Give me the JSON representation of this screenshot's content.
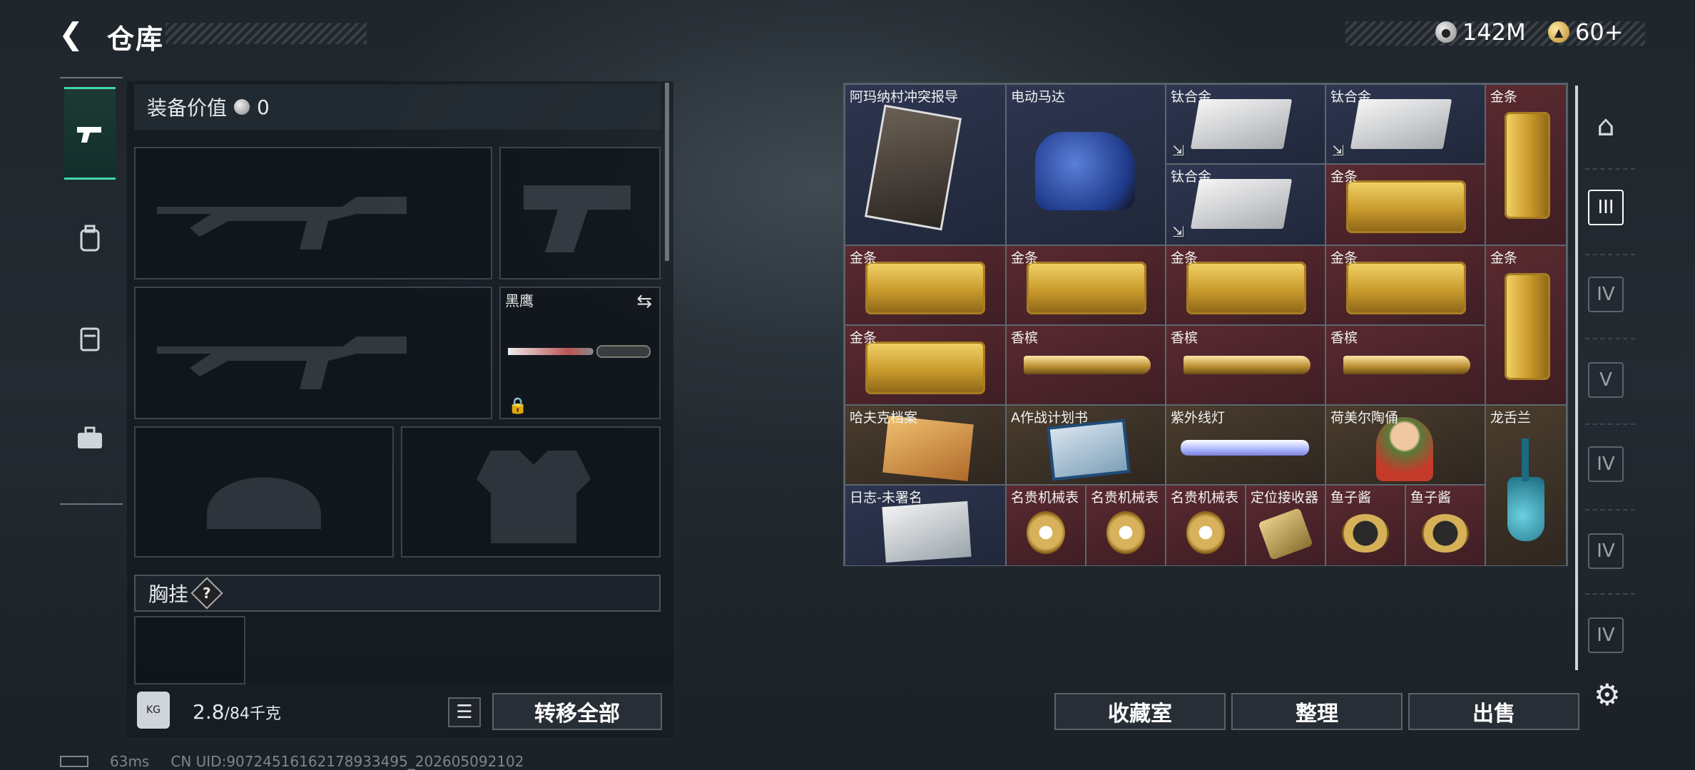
{
  "header": {
    "back_icon": "back-arrow-icon",
    "title": "仓库"
  },
  "currency": {
    "silver": "142M",
    "gold": "60+"
  },
  "equipment": {
    "value_label": "装备价值",
    "value": "0",
    "knife_label": "黑鹰",
    "chest_label": "胸挂",
    "chest_help": "?",
    "weight_current": "2.8",
    "weight_max": "/84千克",
    "transfer_all": "转移全部"
  },
  "storage": {
    "cells": [
      {
        "label": "阿玛纳村冲突报导",
        "kind": "magazine"
      },
      {
        "label": "电动马达",
        "kind": "motor"
      },
      {
        "label": "钛合金",
        "kind": "titanium"
      },
      {
        "label": "钛合金",
        "kind": "titanium"
      },
      {
        "label": "金条",
        "kind": "gold-v"
      },
      {
        "label": "钛合金",
        "kind": "titanium"
      },
      {
        "label": "金条",
        "kind": "gold-h"
      },
      {
        "label": "金条",
        "kind": "gold-h"
      },
      {
        "label": "金条",
        "kind": "gold-h"
      },
      {
        "label": "金条",
        "kind": "gold-h"
      },
      {
        "label": "金条",
        "kind": "gold-h"
      },
      {
        "label": "金条",
        "kind": "gold-v"
      },
      {
        "label": "金条",
        "kind": "gold-h"
      },
      {
        "label": "香槟",
        "kind": "bottle"
      },
      {
        "label": "香槟",
        "kind": "bottle"
      },
      {
        "label": "香槟",
        "kind": "bottle"
      },
      {
        "label": "哈夫克档案",
        "kind": "file"
      },
      {
        "label": "A作战计划书",
        "kind": "book"
      },
      {
        "label": "紫外线灯",
        "kind": "lamp"
      },
      {
        "label": "荷美尔陶俑",
        "kind": "figurine"
      },
      {
        "label": "龙舌兰",
        "kind": "tequila"
      },
      {
        "label": "日志-未署名",
        "kind": "log"
      },
      {
        "label": "名贵机械表",
        "kind": "watch"
      },
      {
        "label": "名贵机械表",
        "kind": "watch"
      },
      {
        "label": "名贵机械表",
        "kind": "watch"
      },
      {
        "label": "定位接收器",
        "kind": "receiver"
      },
      {
        "label": "鱼子酱",
        "kind": "caviar"
      },
      {
        "label": "鱼子酱",
        "kind": "caviar"
      }
    ],
    "buttons": {
      "collection": "收藏室",
      "sort": "整理",
      "sell": "出售"
    }
  },
  "right_nav": {
    "tab_iii": "III",
    "tab_iv": "IV",
    "tab_v": "V"
  },
  "status": {
    "ping": "63ms",
    "uid": "CN UID:9072451616217893349​5_202605092102"
  }
}
